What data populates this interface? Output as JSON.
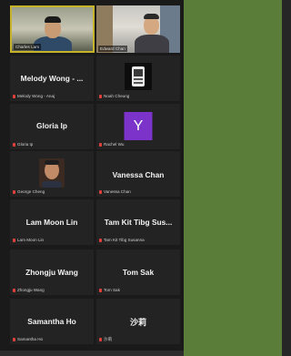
{
  "participants": [
    {
      "id": "charles",
      "name": "Charles Lam",
      "plate": "Charles Lam",
      "type": "video",
      "active": true
    },
    {
      "id": "edward",
      "name": "Edward Chan",
      "plate": "Edward Chan",
      "type": "video",
      "active": false
    },
    {
      "id": "melody",
      "name": "Melody Wong - ...",
      "plate": "Melody Wong - Anaj",
      "type": "name"
    },
    {
      "id": "noah",
      "name": "Noah Cheung",
      "plate": "Noah Cheung",
      "type": "logo"
    },
    {
      "id": "gloria",
      "name": "Gloria Ip",
      "plate": "Gloria Ip",
      "type": "name"
    },
    {
      "id": "rachel",
      "name": "Rachel Wu",
      "plate": "Rachel Wu",
      "type": "letter",
      "letter": "Y",
      "letter_color": "#7b33c9"
    },
    {
      "id": "george",
      "name": "George Cheng",
      "plate": "George Cheng",
      "type": "photo"
    },
    {
      "id": "vanessa",
      "name": "Vanessa Chan",
      "plate": "Vanessa Chan",
      "type": "name"
    },
    {
      "id": "lammoonlin",
      "name": "Lam Moon Lin",
      "plate": "Lam Moon Lin",
      "type": "name"
    },
    {
      "id": "tamkit",
      "name": "Tam Kit Tibg Sus...",
      "plate": "Tam Kit Tibg Susanna",
      "type": "name"
    },
    {
      "id": "zhongju",
      "name": "Zhongju Wang",
      "plate": "Zhongju Wang",
      "type": "name"
    },
    {
      "id": "tomsak",
      "name": "Tom Sak",
      "plate": "Tom Sak",
      "type": "name"
    },
    {
      "id": "samantha",
      "name": "Samantha Ho",
      "plate": "Samantha Ho",
      "type": "name"
    },
    {
      "id": "sali",
      "name": "沙莉",
      "plate": "沙莉",
      "type": "name"
    }
  ],
  "colors": {
    "active_border": "#c6b32a",
    "tile_bg": "#232323",
    "mute_icon": "#e0413a",
    "right_panel": "#5a7d3a"
  },
  "icons": {
    "muted": "mic-muted-icon"
  }
}
